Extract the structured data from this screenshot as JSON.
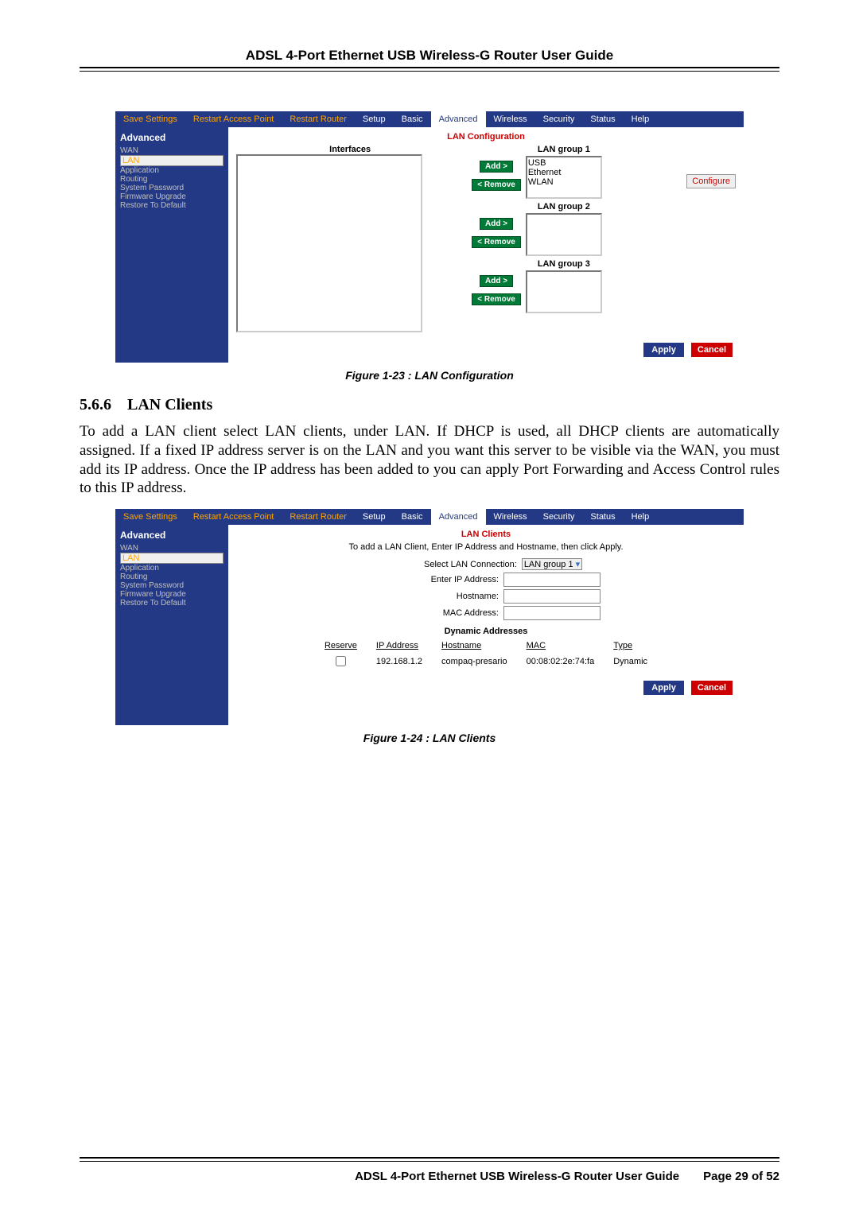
{
  "header": {
    "title": "ADSL 4-Port Ethernet USB Wireless-G Router User Guide"
  },
  "footer": {
    "title": "ADSL 4-Port Ethernet USB Wireless-G Router User Guide",
    "page": "Page 29 of 52"
  },
  "captions": {
    "fig1": "Figure 1-23 : LAN Configuration",
    "fig2": "Figure 1-24 : LAN Clients"
  },
  "section": {
    "number": "5.6.6",
    "title": "LAN Clients",
    "body": "To add a LAN client select LAN clients, under LAN. If DHCP is used, all DHCP clients are automatically assigned.  If a fixed IP address server is on the LAN and you want this server to be visible via the WAN, you must add its IP address. Once the IP address has been added to you can apply Port Forwarding and Access Control rules to this IP address."
  },
  "shot1": {
    "nav": [
      "Save Settings",
      "Restart Access Point",
      "Restart Router",
      "Setup",
      "Basic",
      "Advanced",
      "Wireless",
      "Security",
      "Status",
      "Help"
    ],
    "nav_active": "Advanced",
    "sidebar": {
      "heading": "Advanced",
      "items": [
        "WAN",
        "LAN",
        "Application",
        "Routing",
        "System Password",
        "Firmware Upgrade",
        "Restore To Default"
      ],
      "selected": "LAN"
    },
    "title": "LAN Configuration",
    "interfaces_label": "Interfaces",
    "groups": [
      {
        "name": "LAN group 1",
        "entries": [
          "USB",
          "Ethernet",
          "WLAN"
        ]
      },
      {
        "name": "LAN group 2",
        "entries": []
      },
      {
        "name": "LAN group 3",
        "entries": []
      }
    ],
    "add_label": "Add >",
    "remove_label": "< Remove",
    "configure_label": "Configure",
    "apply": "Apply",
    "cancel": "Cancel"
  },
  "shot2": {
    "nav": [
      "Save Settings",
      "Restart Access Point",
      "Restart Router",
      "Setup",
      "Basic",
      "Advanced",
      "Wireless",
      "Security",
      "Status",
      "Help"
    ],
    "nav_active": "Advanced",
    "sidebar": {
      "heading": "Advanced",
      "items": [
        "WAN",
        "LAN",
        "Application",
        "Routing",
        "System Password",
        "Firmware Upgrade",
        "Restore To Default"
      ],
      "selected": "LAN"
    },
    "title": "LAN Clients",
    "subtitle": "To add a LAN Client, Enter IP Address and Hostname, then click Apply.",
    "fields": {
      "select_conn": "Select LAN Connection:",
      "select_value": "LAN group 1",
      "ip": "Enter IP Address:",
      "hostname": "Hostname:",
      "mac": "MAC Address:"
    },
    "dyn_title": "Dynamic Addresses",
    "table_headers": [
      "Reserve",
      "IP Address",
      "Hostname",
      "MAC",
      "Type"
    ],
    "rows": [
      {
        "reserve": false,
        "ip": "192.168.1.2",
        "hostname": "compaq-presario",
        "mac": "00:08:02:2e:74:fa",
        "type": "Dynamic"
      }
    ],
    "apply": "Apply",
    "cancel": "Cancel"
  }
}
